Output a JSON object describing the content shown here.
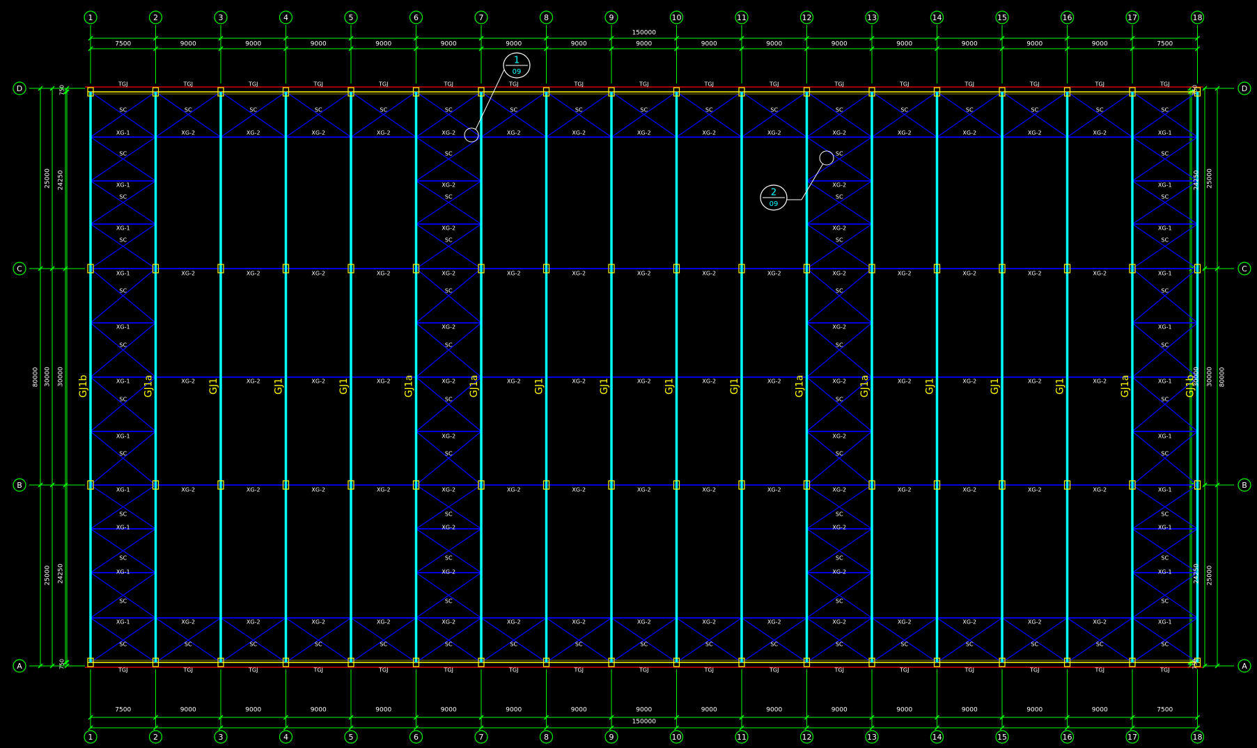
{
  "colors": {
    "background": "#000000",
    "grid": "#00ff00",
    "column": "#00ffff",
    "bracing": "#0000ff",
    "label_white": "#ffffff",
    "frame_label": "#ffff00",
    "detail": "#00ffff",
    "purlin_red": "#ff0000"
  },
  "axes": {
    "columns": [
      "1",
      "2",
      "3",
      "4",
      "5",
      "6",
      "7",
      "8",
      "9",
      "10",
      "11",
      "12",
      "13",
      "14",
      "15",
      "16",
      "17",
      "18"
    ],
    "rows": [
      "D",
      "C",
      "B",
      "A"
    ]
  },
  "dims": {
    "horizontal_spans": [
      "7500",
      "9000",
      "9000",
      "9000",
      "9000",
      "9000",
      "9000",
      "9000",
      "9000",
      "9000",
      "9000",
      "9000",
      "9000",
      "9000",
      "9000",
      "9000",
      "7500"
    ],
    "horizontal_total": "150000",
    "vertical_outer_total": "80000",
    "vertical_outer": [
      "25000",
      "30000",
      "25000"
    ],
    "vertical_inner": [
      "24250",
      "30000",
      "24250"
    ],
    "edge_offset": "750"
  },
  "labels": {
    "tie_beam": "TGJ",
    "horizontal_brace": "SC",
    "strut_1": "XG-1",
    "strut_2": "XG-2"
  },
  "frames": [
    "GJ1b",
    "GJ1a",
    "GJ1",
    "GJ1",
    "GJ1",
    "GJ1a",
    "GJ1a",
    "GJ1",
    "GJ1",
    "GJ1",
    "GJ1",
    "GJ1a",
    "GJ1a",
    "GJ1",
    "GJ1",
    "GJ1",
    "GJ1a",
    "GJ1b"
  ],
  "details": [
    {
      "num": "1",
      "sheet": "09"
    },
    {
      "num": "2",
      "sheet": "09"
    }
  ]
}
